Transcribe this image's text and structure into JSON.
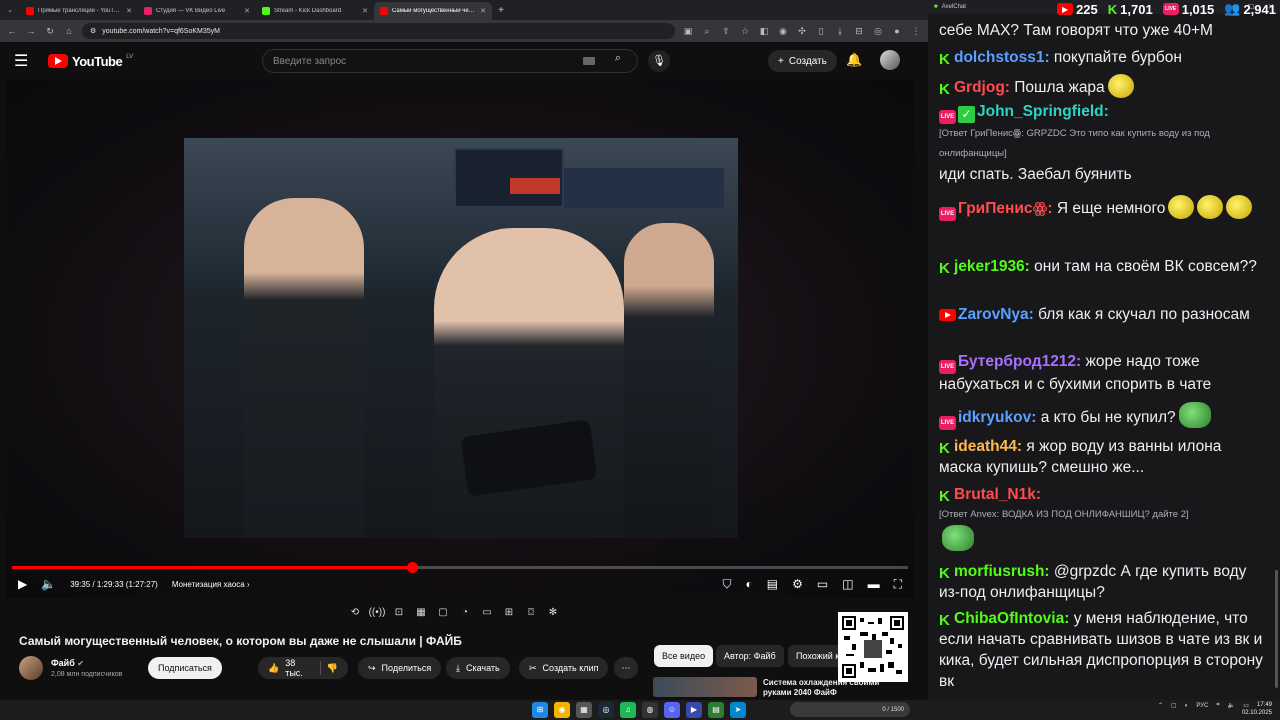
{
  "browser": {
    "tabs": [
      {
        "label": "Прямые трансляции - YouTube",
        "color": "#ff0000",
        "active": false
      },
      {
        "label": "Студия — VK Видео Live",
        "color": "#e91e63",
        "active": false
      },
      {
        "label": "Stream - Kick Dashboard",
        "color": "#53fc18",
        "active": false
      },
      {
        "label": "Самый могущественный чел...",
        "color": "#ff0000",
        "active": true
      }
    ],
    "new_tab": "+",
    "url": "youtube.com/watch?v=qf6SoKM35yM"
  },
  "stream_stats": [
    {
      "platform": "youtube",
      "icon": "youtube-icon",
      "value": "225",
      "color": "#ff0000"
    },
    {
      "platform": "kick",
      "icon": "kick-icon",
      "value": "1,701",
      "color": "#53fc18"
    },
    {
      "platform": "vk",
      "icon": "live-icon",
      "value": "1,015",
      "color": "#e91e63"
    },
    {
      "platform": "total",
      "icon": "users-icon",
      "value": "2,941",
      "color": "#5aa0ff"
    }
  ],
  "youtube": {
    "logo": "YouTube",
    "region": "LV",
    "search_placeholder": "Введите запрос",
    "create_label": "Создать"
  },
  "player": {
    "progress": 0.4466,
    "time": "39:35 / 1:29:33 (1:27:27)",
    "chapter": "Монетизация хаоса",
    "chapter_chevron": "›"
  },
  "video": {
    "title": "Самый могущественный человек, о котором вы даже не слышали | ФАЙБ",
    "channel": "Файб",
    "subscribers": "2,08 млн подписчиков",
    "subscribe_label": "Подписаться",
    "likes": "38 тыс.",
    "share_label": "Поделиться",
    "download_label": "Скачать",
    "clip_label": "Создать клип",
    "more_label": "⋯"
  },
  "sidebar": {
    "chips": [
      "Все видео",
      "Автор: Файб",
      "Похожий к"
    ],
    "rec_title": "Система охлаждения своими руками 2040 ФайФ"
  },
  "chat": {
    "app_title": "AxelChat",
    "messages": [
      {
        "badge": "none",
        "user": "",
        "color": "#efeff1",
        "reply": "",
        "text": "себе MAX? Там говорят что уже 40+М",
        "emotes": []
      },
      {
        "badge": "kick",
        "user": "dolchstoss1:",
        "color": "#5aa0ff",
        "reply": "",
        "text": "покупайте бурбон",
        "emotes": []
      },
      {
        "badge": "kick",
        "user": "Grdjog:",
        "color": "#ff4d4d",
        "reply": "",
        "text": "Пошла жара",
        "emotes": [
          "yellow"
        ]
      },
      {
        "badge": "live-check",
        "user": "John_Springfield:",
        "color": "#2fd3c3",
        "reply": "[Ответ ГриПенисꙮ: GRPZDC Это типо как купить воду из под онлифанщицы]",
        "text": "иди спать. Заебал буянить",
        "emotes": []
      },
      {
        "badge": "live",
        "user": "ГриПенисꙮ:",
        "color": "#ff4d4d",
        "reply": "",
        "text": "Я еще немного",
        "emotes": [
          "yellow",
          "yellow",
          "yellow"
        ]
      },
      {
        "badge": "kick",
        "user": "jeker1936:",
        "color": "#53fc18",
        "reply": "",
        "text": "они там на своём ВК совсем??",
        "emotes": []
      },
      {
        "badge": "youtube",
        "user": "ZarovNya:",
        "color": "#5aa0ff",
        "reply": "",
        "text": "бля как я скучал по разносам",
        "emotes": []
      },
      {
        "badge": "live",
        "user": "Бутерброд1212:",
        "color": "#a970ff",
        "reply": "",
        "text": "жоре надо тоже набухаться и с бухими спорить в чате",
        "emotes": []
      },
      {
        "badge": "live",
        "user": "idkryukov:",
        "color": "#5aa0ff",
        "reply": "",
        "text": "а кто бы не купил?",
        "emotes": [
          "pepe"
        ]
      },
      {
        "badge": "kick",
        "user": "ideath44:",
        "color": "#ffb84d",
        "reply": "",
        "text": "я жор воду из ванны илона маска купишь? смешно же...",
        "emotes": []
      },
      {
        "badge": "kick",
        "user": "Brutal_N1k:",
        "color": "#ff4d4d",
        "reply": "[Ответ Anvex: ВОДКА ИЗ ПОД ОНЛИФАНШИЦ? дайте 2]",
        "text": "",
        "emotes": [
          "pepe"
        ]
      },
      {
        "badge": "kick",
        "user": "morfiusrush:",
        "color": "#53fc18",
        "reply": "",
        "text": "@grpzdc А где купить воду из-под онлифанщицы?",
        "emotes": []
      },
      {
        "badge": "kick",
        "user": "ChibaOfIntovia:",
        "color": "#53fc18",
        "reply": "",
        "text": "у меня наблюдение, что если начать сравнивать шизов в чате из вк и кика, будет сильная диспропорция в сторону вк",
        "emotes": []
      }
    ]
  },
  "taskbar": {
    "media_text": "0 / 1500",
    "lang": "РУС",
    "time": "17:49",
    "date": "02.10.2025"
  }
}
